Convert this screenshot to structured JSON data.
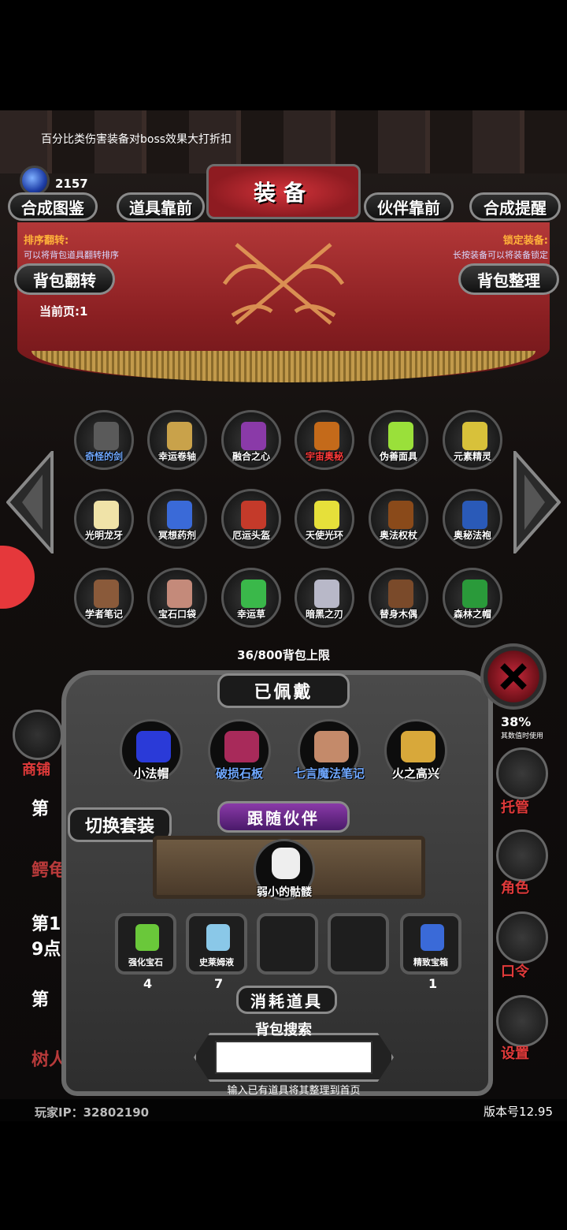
{
  "top": {
    "tip": "百分比类伤害装备对boss效果大打折扣",
    "gem_value": "2157"
  },
  "header": {
    "title": "装备",
    "tabs": [
      "合成图鉴",
      "道具靠前",
      "伙伴靠前",
      "合成提醒"
    ]
  },
  "notes": {
    "left_title": "排序翻转:",
    "left_sub": "可以将背包道具翻转排序",
    "right_title": "锁定装备:",
    "right_sub": "长按装备可以将装备锁定"
  },
  "buttons": {
    "flip": "背包翻转",
    "sort": "背包整理",
    "switch_set": "切换套装"
  },
  "current_page": "当前页:1",
  "inventory": {
    "items": [
      {
        "label": "奇怪的剑",
        "color": "#5a5a5a",
        "label_color": "#6fa8ff"
      },
      {
        "label": "幸运卷轴",
        "color": "#c9a24a",
        "label_color": "#ffffff"
      },
      {
        "label": "融合之心",
        "color": "#8a3aa8",
        "label_color": "#ffffff"
      },
      {
        "label": "宇宙奥秘",
        "color": "#c46a1a",
        "label_color": "#ff3a3a"
      },
      {
        "label": "伪善面具",
        "color": "#9ae03a",
        "label_color": "#ffffff"
      },
      {
        "label": "元素精灵",
        "color": "#d8c13a",
        "label_color": "#ffffff"
      },
      {
        "label": "光明龙牙",
        "color": "#f0e3a8",
        "label_color": "#ffffff"
      },
      {
        "label": "冥想药剂",
        "color": "#3a6ad8",
        "label_color": "#ffffff"
      },
      {
        "label": "厄运头盔",
        "color": "#c43a2a",
        "label_color": "#ffffff"
      },
      {
        "label": "天使光环",
        "color": "#e6e03a",
        "label_color": "#ffffff"
      },
      {
        "label": "奥法权杖",
        "color": "#8a4a1a",
        "label_color": "#ffffff"
      },
      {
        "label": "奥秘法袍",
        "color": "#2a5ab8",
        "label_color": "#ffffff"
      },
      {
        "label": "学者笔记",
        "color": "#8a5a3a",
        "label_color": "#ffffff"
      },
      {
        "label": "宝石口袋",
        "color": "#c48a7a",
        "label_color": "#ffffff"
      },
      {
        "label": "幸运草",
        "color": "#3ab84a",
        "label_color": "#ffffff"
      },
      {
        "label": "暗黑之刃",
        "color": "#b8b8c8",
        "label_color": "#ffffff"
      },
      {
        "label": "替身木偶",
        "color": "#7a4a2a",
        "label_color": "#ffffff"
      },
      {
        "label": "森林之帽",
        "color": "#2a9a3a",
        "label_color": "#ffffff"
      }
    ],
    "capacity": "36/800背包上限"
  },
  "equipped": {
    "title": "已佩戴",
    "items": [
      {
        "label": "小法帽",
        "color": "#2a3ad8",
        "label_color": "#ffffff"
      },
      {
        "label": "破损石板",
        "color": "#a82a5a",
        "label_color": "#6fa8ff"
      },
      {
        "label": "七言魔法笔记",
        "color": "#c48a6a",
        "label_color": "#6fa8ff"
      },
      {
        "label": "火之高兴",
        "color": "#d8a83a",
        "label_color": "#ffffff"
      }
    ]
  },
  "partner": {
    "title": "跟随伙伴",
    "name": "弱小的骷髅"
  },
  "consumables": {
    "title": "消耗道具",
    "slots": [
      {
        "label": "强化宝石",
        "count": "4",
        "color": "#6ac83a"
      },
      {
        "label": "史莱姆液",
        "count": "7",
        "color": "#8ac8e8"
      },
      {
        "label": "",
        "count": "",
        "color": ""
      },
      {
        "label": "",
        "count": "",
        "color": ""
      },
      {
        "label": "精致宝箱",
        "count": "1",
        "color": "#3a6ad8"
      }
    ]
  },
  "search": {
    "title": "背包搜索",
    "value": "",
    "hint": "输入已有道具将其整理到首页"
  },
  "sidebar": {
    "shop": "商铺",
    "dice": "托管",
    "role": "角色",
    "code": "口令",
    "settings": "设置",
    "percent": "38%",
    "percent_sub": "其数值时使用"
  },
  "background": {
    "line1": "第",
    "line2": "鳄龟",
    "line3": "第1",
    "line4": "9点",
    "line5": "第",
    "line6": "树人被击败掉落金"
  },
  "footer": {
    "player_ip": "玩家IP：32802190",
    "version": "版本号12.95"
  }
}
